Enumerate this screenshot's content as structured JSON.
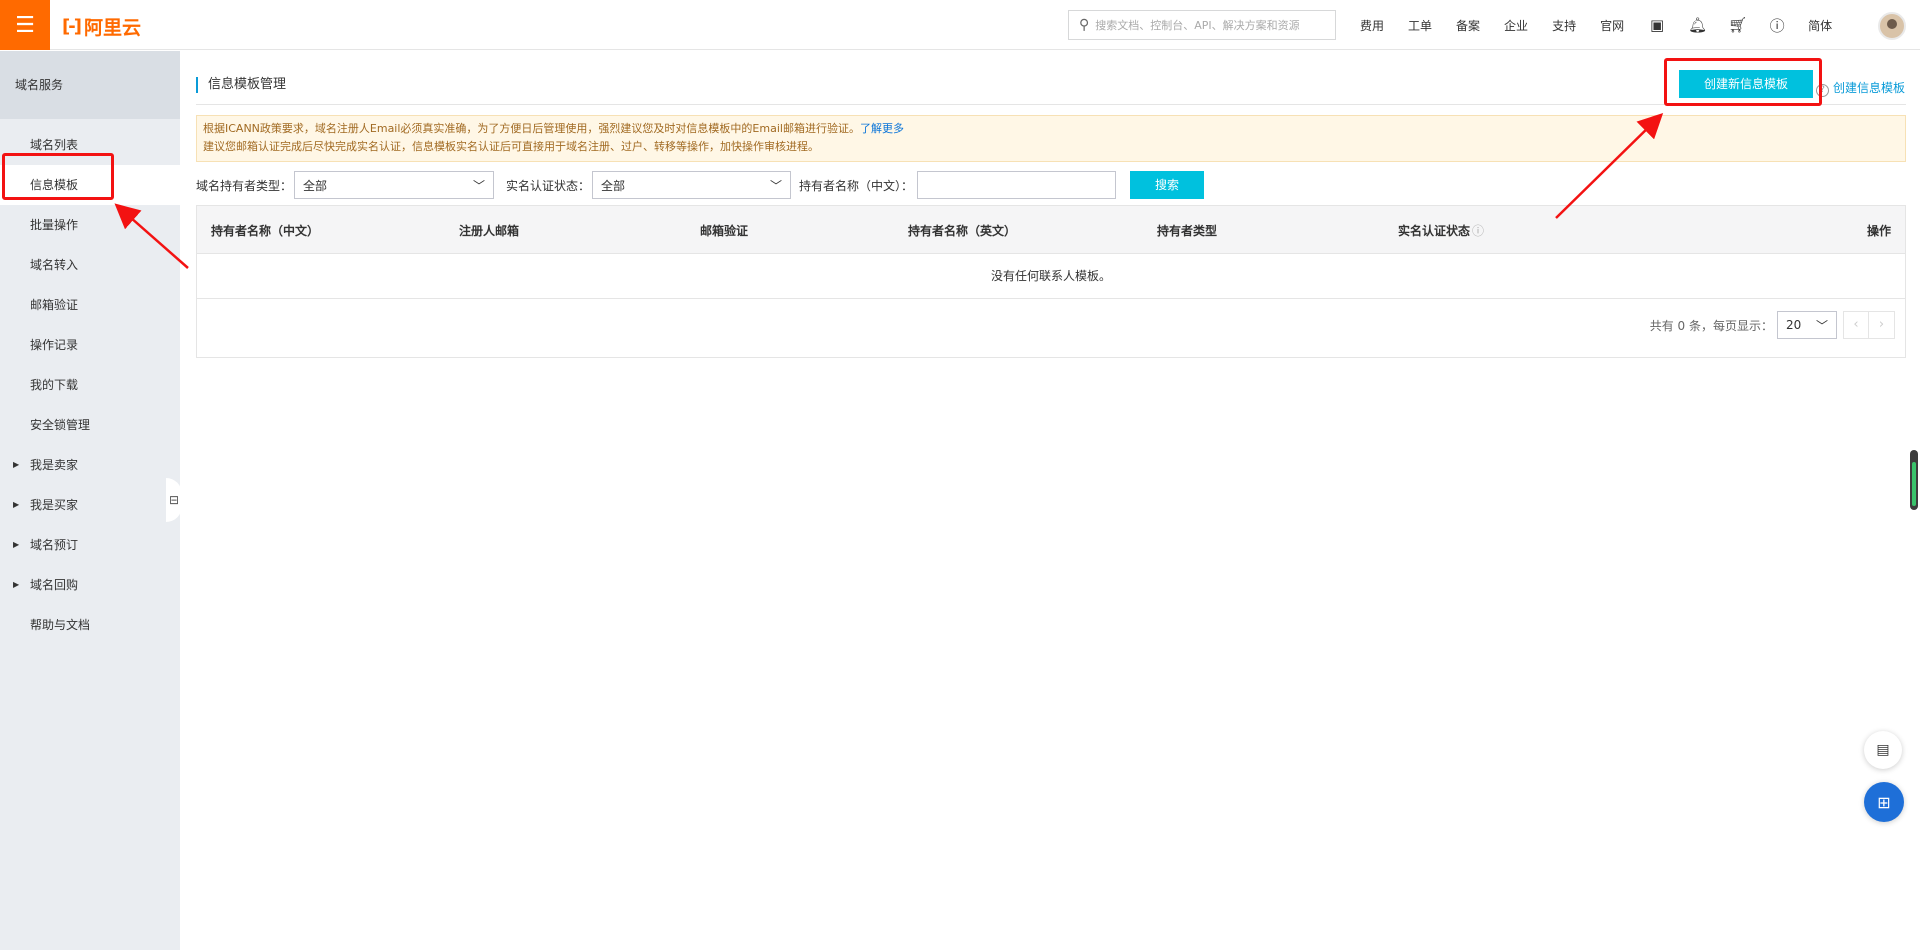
{
  "brand": {
    "logo_text": "阿里云",
    "accent": "#ff6a00"
  },
  "topbar": {
    "search_placeholder": "搜索文档、控制台、API、解决方案和资源",
    "links": [
      "费用",
      "工单",
      "备案",
      "企业",
      "支持",
      "官网"
    ],
    "lang": "简体"
  },
  "sidebar": {
    "title": "域名服务",
    "items": [
      {
        "label": "域名列表"
      },
      {
        "label": "信息模板"
      },
      {
        "label": "批量操作"
      },
      {
        "label": "域名转入"
      },
      {
        "label": "邮箱验证"
      },
      {
        "label": "操作记录"
      },
      {
        "label": "我的下载"
      },
      {
        "label": "安全锁管理"
      },
      {
        "label": "我是卖家"
      },
      {
        "label": "我是买家"
      },
      {
        "label": "域名预订"
      },
      {
        "label": "域名回购"
      },
      {
        "label": "帮助与文档"
      }
    ]
  },
  "page": {
    "title": "信息模板管理",
    "create_button": "创建新信息模板",
    "create_link": "创建信息模板",
    "notice_line1": "根据ICANN政策要求，域名注册人Email必须真实准确，为了方便日后管理使用，强烈建议您及时对信息模板中的Email邮箱进行验证。",
    "notice_link": "了解更多",
    "notice_line2": "建议您邮箱认证完成后尽快完成实名认证，信息模板实名认证后可直接用于域名注册、过户、转移等操作，加快操作审核进程。"
  },
  "filters": {
    "type_label": "域名持有者类型：",
    "type_value": "全部",
    "status_label": "实名认证状态：",
    "status_value": "全部",
    "name_label": "持有者名称（中文）：",
    "name_value": "",
    "search_button": "搜索"
  },
  "table": {
    "columns": [
      "持有者名称（中文）",
      "注册人邮箱",
      "邮箱验证",
      "持有者名称（英文）",
      "持有者类型",
      "实名认证状态",
      "操作"
    ],
    "empty_text": "没有任何联系人模板。"
  },
  "pagination": {
    "summary": "共有 0 条，每页显示：",
    "page_size": "20"
  }
}
